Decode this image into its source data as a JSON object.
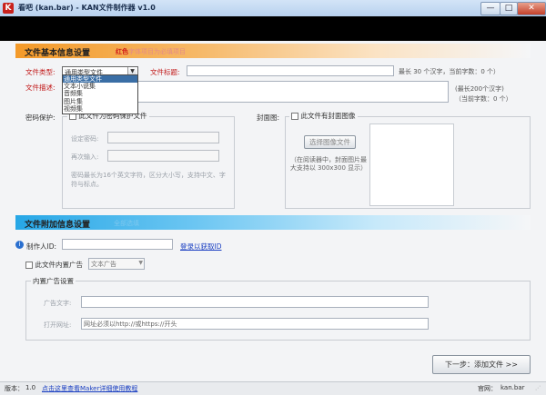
{
  "window": {
    "title": "看吧 (kan.bar) - KAN文件制作器 v1.0",
    "icon": "app-logo-icon",
    "controls": {
      "minimize": "—",
      "maximize": "□",
      "close": "✕"
    }
  },
  "section_basic": {
    "title": "文件基本信息设置",
    "note_red": "红色",
    "note_rest": "字体项目为必填项目"
  },
  "file_type": {
    "label": "文件类型:",
    "value": "通用类型文件",
    "options": [
      "通用类型文件",
      "文本小说集",
      "音频集",
      "图片集",
      "视频集"
    ]
  },
  "file_title": {
    "label": "文件标题:",
    "value": "",
    "hint": "最长 30 个汉字，当前字数：0 个）"
  },
  "file_desc": {
    "label": "文件描述:",
    "hint1": "(最长200个汉字)",
    "hint2": "（当前字数：0 个）"
  },
  "password": {
    "label": "密码保护:",
    "checkbox": "此文件为密码保护文件",
    "set_label": "设定密码:",
    "confirm_label": "再次输入:",
    "note": "密码最长为16个英文字符，区分大小写，支持中文、字符与标点。"
  },
  "cover": {
    "label": "封面图:",
    "checkbox": "此文件有封面图像",
    "button": "选择图像文件",
    "note": "（在阅读器中，封面图片最大支持以 300x300 显示）"
  },
  "section_extra": {
    "title": "文件附加信息设置",
    "note": "全部选填"
  },
  "creator": {
    "label": "制作人ID:",
    "link": "登录以获取ID"
  },
  "ads": {
    "checkbox": "此文件内置广告",
    "type_value": "文本广告",
    "group_title": "内置广告设置",
    "text_label": "广告文字:",
    "url_label": "打开网址:",
    "url_placeholder": "网址必须以http://或https://开头"
  },
  "next_button": "下一步：添加文件 >>",
  "status": {
    "version_label": "版本：",
    "version": "1.0",
    "link": "点击这里查看Maker详细使用教程",
    "site_label": "官网：",
    "site": "kan.bar"
  }
}
